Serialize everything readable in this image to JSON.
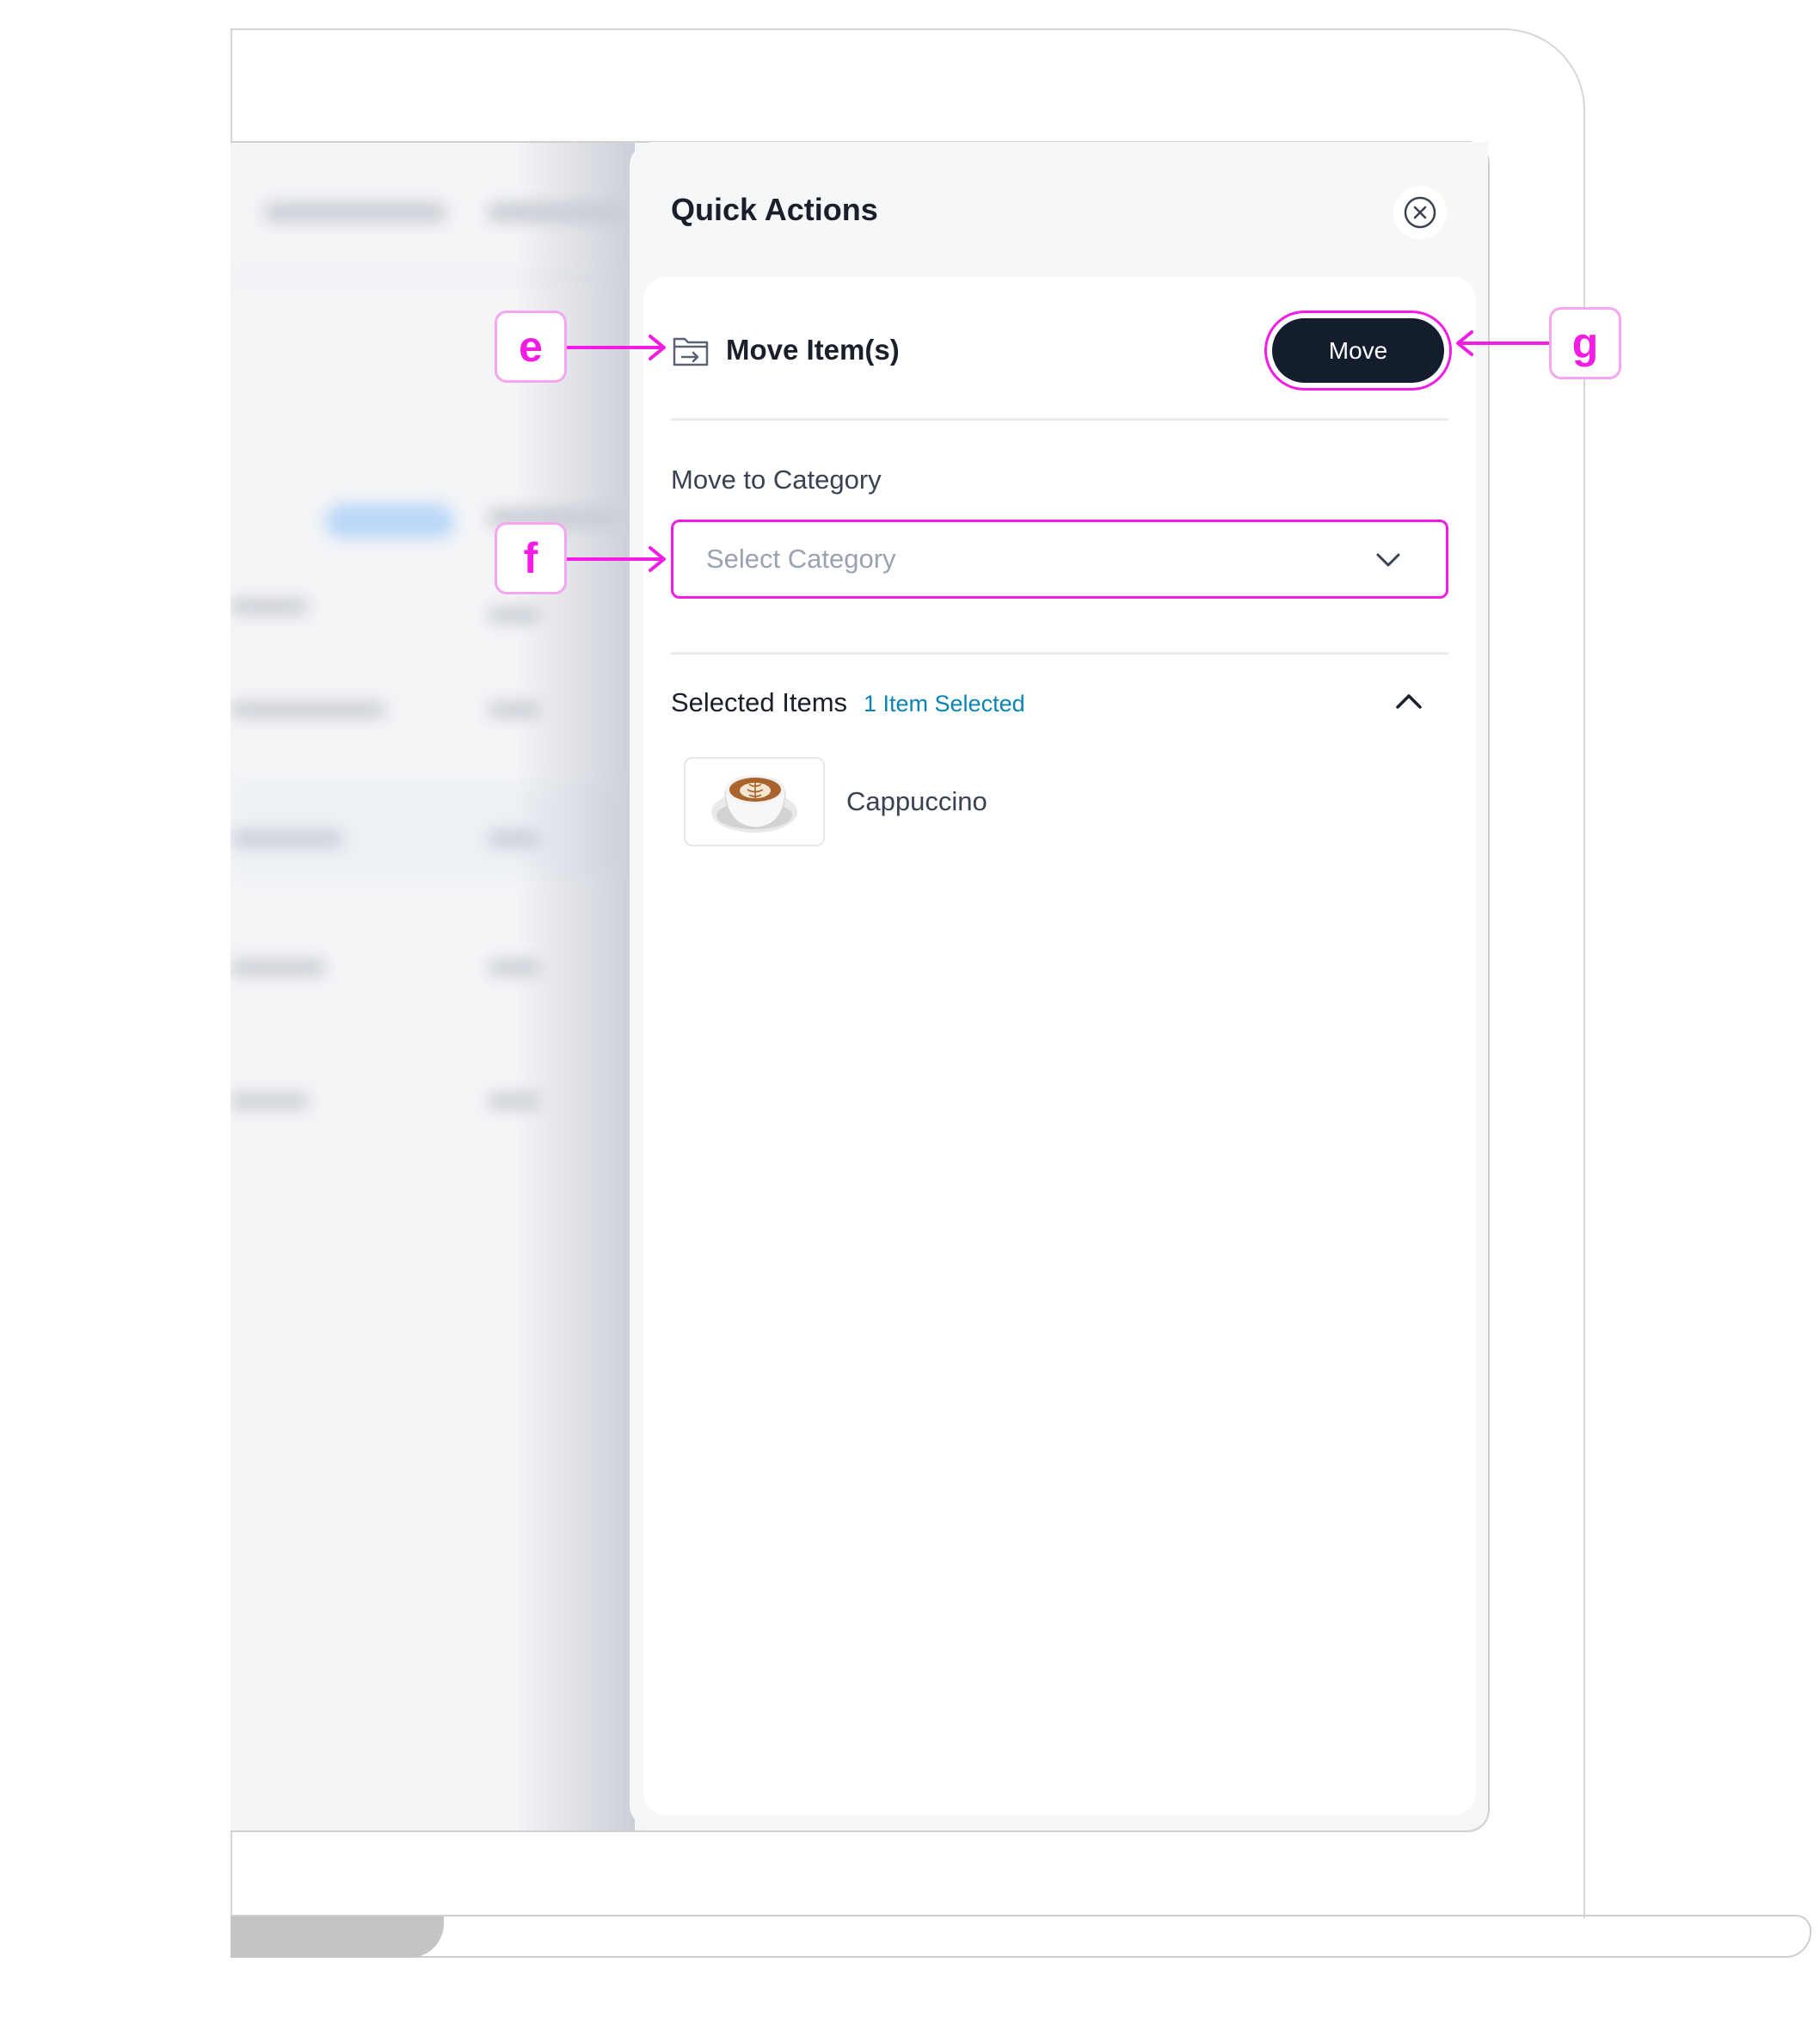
{
  "panel": {
    "title": "Quick Actions"
  },
  "move_card": {
    "title": "Move Item(s)",
    "move_button_label": "Move",
    "category_label": "Move to Category",
    "category_placeholder": "Select Category"
  },
  "selected_items": {
    "title": "Selected Items",
    "count_label": "1 Item Selected",
    "items": [
      {
        "name": "Cappuccino",
        "image": "latte-art-cup-icon"
      }
    ]
  },
  "annotations": {
    "e": "e",
    "f": "f",
    "g": "g"
  },
  "colors": {
    "highlight": "#f21ce4",
    "primary_button": "#141d2e",
    "count_text": "#0a83b6"
  }
}
